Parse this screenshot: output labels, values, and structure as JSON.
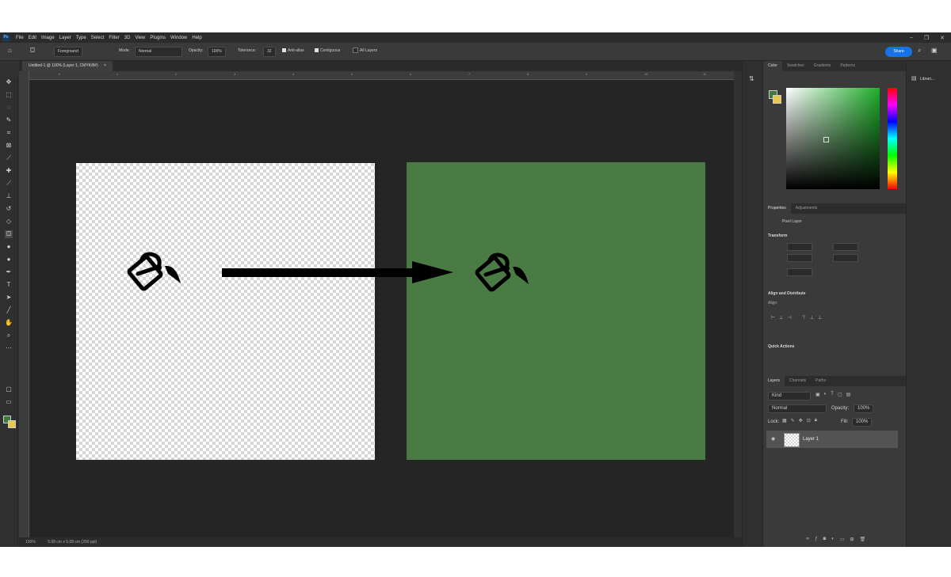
{
  "app": {
    "logo": "Ps"
  },
  "menu": [
    "File",
    "Edit",
    "Image",
    "Layer",
    "Type",
    "Select",
    "Filter",
    "3D",
    "View",
    "Plugins",
    "Window",
    "Help"
  ],
  "options": {
    "fill_source": "Foreground",
    "mode_label": "Mode:",
    "mode_value": "Normal",
    "opacity_label": "Opacity:",
    "opacity_value": "100%",
    "tolerance_label": "Tolerance:",
    "tolerance_value": "32",
    "antialias_label": "Anti-alias",
    "contiguous_label": "Contiguous",
    "all_layers_label": "All Layers",
    "share_label": "Share"
  },
  "document": {
    "tab_title": "Untitled-1 @ 100% (Layer 1, CMYK/8#)",
    "close": "×"
  },
  "status": {
    "zoom": "100%",
    "info": "5.08 cm x 5.08 cm (200 ppi)"
  },
  "rulers": {
    "h": [
      "0",
      "1",
      "2",
      "3",
      "4",
      "5",
      "6",
      "7",
      "8",
      "9",
      "10",
      "11"
    ]
  },
  "panels": {
    "color_tabs": [
      "Color",
      "Swatches",
      "Gradients",
      "Patterns"
    ],
    "properties_tabs": [
      "Properties",
      "Adjustments"
    ],
    "pixel_layer": "Pixel Layer",
    "transform": "Transform",
    "align": "Align and Distribute",
    "align_sub": "Align:",
    "quick_actions": "Quick Actions",
    "layers_tabs": [
      "Layers",
      "Channels",
      "Paths"
    ],
    "kind": "Kind",
    "blend_mode": "Normal",
    "layer_opacity_label": "Opacity:",
    "layer_opacity_value": "100%",
    "lock_label": "Lock:",
    "fill_label": "Fill:",
    "fill_value": "100%",
    "layer_name": "Layer 1",
    "libraries": "Librari..."
  },
  "colors": {
    "foreground": "#3e7a3b",
    "background": "#e8c84a",
    "canvas_fill": "#4b7b44",
    "accent": "#1473e6"
  },
  "icons": {
    "paint_bucket": "paint-bucket-icon",
    "arrow": "right-arrow"
  }
}
